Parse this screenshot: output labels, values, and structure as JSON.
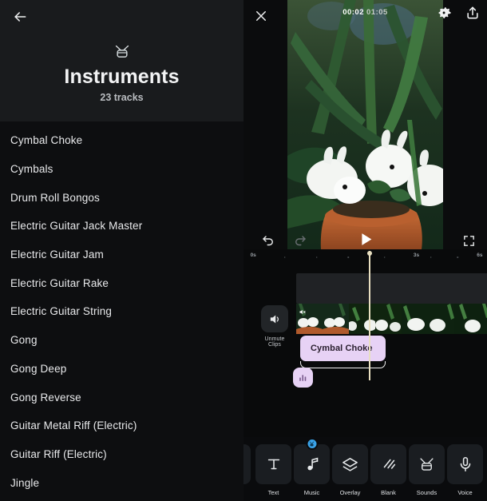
{
  "left_panel": {
    "back_icon": "arrow-left-icon",
    "header_icon": "drum-icon",
    "title": "Instruments",
    "subtitle": "23 tracks",
    "tracks": [
      {
        "name": "Cymbal Choke"
      },
      {
        "name": "Cymbals"
      },
      {
        "name": "Drum Roll Bongos"
      },
      {
        "name": "Electric Guitar Jack Master"
      },
      {
        "name": "Electric Guitar Jam"
      },
      {
        "name": "Electric Guitar Rake"
      },
      {
        "name": "Electric Guitar String"
      },
      {
        "name": "Gong"
      },
      {
        "name": "Gong Deep"
      },
      {
        "name": "Gong Reverse"
      },
      {
        "name": "Guitar Metal Riff (Electric)"
      },
      {
        "name": "Guitar Riff (Electric)"
      },
      {
        "name": "Jingle"
      }
    ]
  },
  "preview": {
    "close_icon": "close-icon",
    "settings_icon": "gear-icon",
    "share_icon": "share-export-icon",
    "current_time": "00:02",
    "total_time": "01:05",
    "play_icon": "play-icon",
    "undo_icon": "undo-icon",
    "redo_icon": "redo-icon",
    "fullscreen_icon": "fullscreen-icon"
  },
  "ruler": {
    "ticks": [
      {
        "label": "0s",
        "pos": 4
      },
      {
        "label": "3s",
        "pos": 71
      },
      {
        "label": "6s",
        "pos": 97
      }
    ],
    "dots_pct": [
      17,
      30,
      43,
      58,
      71,
      84
    ]
  },
  "timeline": {
    "unmute_icon": "speaker-icon",
    "unmute_label": "Unmute Clips",
    "audio_clip_label": "Cymbal Choke",
    "audio_clip_color": "#e7d2f5",
    "waveform_badge_icon": "waveform-icon",
    "playhead_color": "#e8dfc0",
    "mini_mute_icon": "speaker-mute-icon"
  },
  "toolbar": {
    "items": [
      {
        "label": "Text",
        "icon": "text-icon",
        "badge": false
      },
      {
        "label": "Music",
        "icon": "music-note-icon",
        "badge": true,
        "badge_icon": "music-badge-icon",
        "badge_color": "#3aa3e8"
      },
      {
        "label": "Overlay",
        "icon": "layers-icon",
        "badge": false
      },
      {
        "label": "Blank",
        "icon": "diagonal-lines-icon",
        "badge": false
      },
      {
        "label": "Sounds",
        "icon": "drum-icon",
        "badge": false
      },
      {
        "label": "Voice",
        "icon": "microphone-icon",
        "badge": false
      }
    ]
  }
}
